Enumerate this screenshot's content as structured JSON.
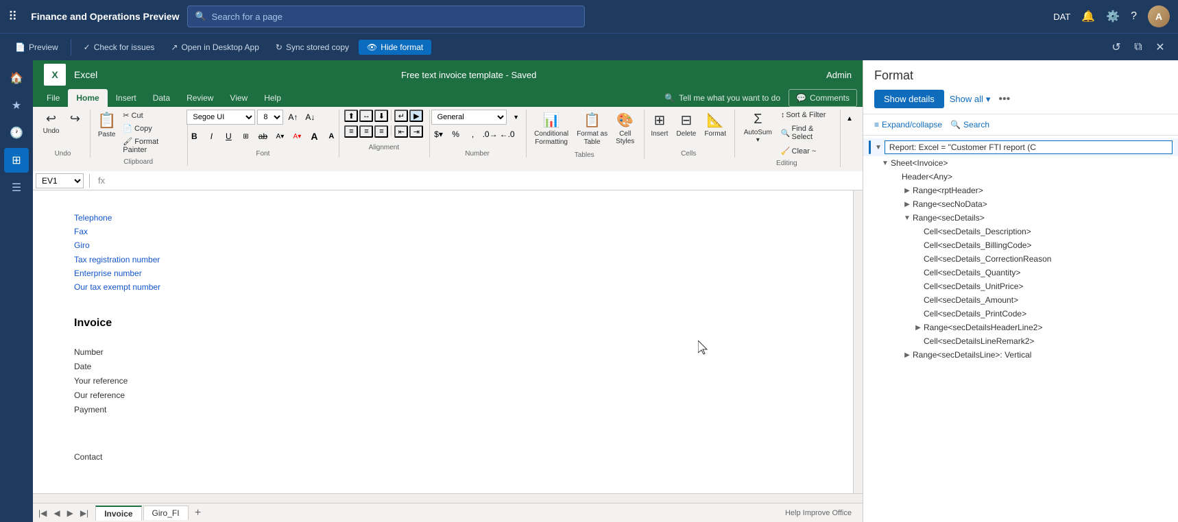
{
  "topNav": {
    "appTitle": "Finance and Operations Preview",
    "searchPlaceholder": "Search for a page",
    "env": "DAT",
    "icons": [
      "waffle",
      "bell",
      "settings",
      "help",
      "avatar"
    ]
  },
  "toolbarBar": {
    "preview": "Preview",
    "checkForIssues": "Check for issues",
    "openInDesktopApp": "Open in Desktop App",
    "syncStoredCopy": "Sync stored copy",
    "hideFormat": "Hide format"
  },
  "excel": {
    "appName": "Excel",
    "fileTitle": "Free text invoice template  -  Saved",
    "adminLabel": "Admin",
    "ribbon": {
      "tabs": [
        "File",
        "Home",
        "Insert",
        "Data",
        "Review",
        "View",
        "Help"
      ],
      "activeTab": "Home",
      "tellMeText": "Tell me what you want to do",
      "commentsLabel": "Comments"
    },
    "fontSection": {
      "fontName": "Segoe UI",
      "fontSize": "8",
      "formatting": [
        "B",
        "I",
        "U"
      ]
    },
    "numberFormat": "General",
    "groups": [
      {
        "label": "Undo",
        "name": "undo-group"
      },
      {
        "label": "Clipboard",
        "name": "clipboard-group"
      },
      {
        "label": "Font",
        "name": "font-group"
      },
      {
        "label": "Alignment",
        "name": "alignment-group"
      },
      {
        "label": "Number",
        "name": "number-group"
      },
      {
        "label": "Tables",
        "name": "tables-group"
      },
      {
        "label": "Cells",
        "name": "cells-group"
      },
      {
        "label": "Editing",
        "name": "editing-group"
      }
    ],
    "ribbonButtons": {
      "autoSum": "AutoSum",
      "sortFilter": "Sort & Filter",
      "findSelect": "Find & Select",
      "conditionalFormatting": "Conditional Formatting",
      "formatAsTable": "Format as Table",
      "format": "Format",
      "clear": "Clear ~",
      "insert": "Insert",
      "delete": "Delete"
    },
    "cellRef": "EV1",
    "sheetContent": {
      "fields": [
        "Telephone",
        "Fax",
        "Giro",
        "Tax registration number",
        "Enterprise number",
        "Our tax exempt number"
      ],
      "invoiceTitle": "Invoice",
      "invoiceFields": [
        "Number",
        "Date",
        "Your reference",
        "Our reference",
        "Payment"
      ],
      "contactLabel": "Contact"
    },
    "sheets": [
      "Invoice",
      "Giro_FI"
    ],
    "activeSheet": "Invoice",
    "statusBarText": "Help Improve Office"
  },
  "rightPanel": {
    "title": "Format",
    "showDetailsBtn": "Show details",
    "showAllBtn": "Show all",
    "expandCollapseBtn": "Expand/collapse",
    "searchBtn": "Search",
    "reportLabel": "Report: Excel = \"Customer FTI report (C",
    "tree": [
      {
        "label": "Sheet<Invoice>",
        "indent": 1,
        "expanded": true,
        "toggle": "▼"
      },
      {
        "label": "Header<Any>",
        "indent": 2,
        "expanded": false,
        "toggle": ""
      },
      {
        "label": "Range<rptHeader>",
        "indent": 3,
        "expanded": false,
        "toggle": "▶"
      },
      {
        "label": "Range<secNoData>",
        "indent": 3,
        "expanded": false,
        "toggle": "▶"
      },
      {
        "label": "Range<secDetails>",
        "indent": 3,
        "expanded": true,
        "toggle": "▼"
      },
      {
        "label": "Cell<secDetails_Description>",
        "indent": 4,
        "expanded": false,
        "toggle": ""
      },
      {
        "label": "Cell<secDetails_BillingCode>",
        "indent": 4,
        "expanded": false,
        "toggle": ""
      },
      {
        "label": "Cell<secDetails_CorrectionReason",
        "indent": 4,
        "expanded": false,
        "toggle": ""
      },
      {
        "label": "Cell<secDetails_Quantity>",
        "indent": 4,
        "expanded": false,
        "toggle": ""
      },
      {
        "label": "Cell<secDetails_UnitPrice>",
        "indent": 4,
        "expanded": false,
        "toggle": ""
      },
      {
        "label": "Cell<secDetails_Amount>",
        "indent": 4,
        "expanded": false,
        "toggle": ""
      },
      {
        "label": "Cell<secDetails_PrintCode>",
        "indent": 4,
        "expanded": false,
        "toggle": ""
      },
      {
        "label": "Range<secDetailsHeaderLine2>",
        "indent": 4,
        "expanded": false,
        "toggle": "▶"
      },
      {
        "label": "Cell<secDetailsLineRemark2>",
        "indent": 4,
        "expanded": false,
        "toggle": ""
      },
      {
        "label": "Range<secDetailsLine>: Vertical",
        "indent": 3,
        "expanded": false,
        "toggle": "▶"
      }
    ]
  }
}
